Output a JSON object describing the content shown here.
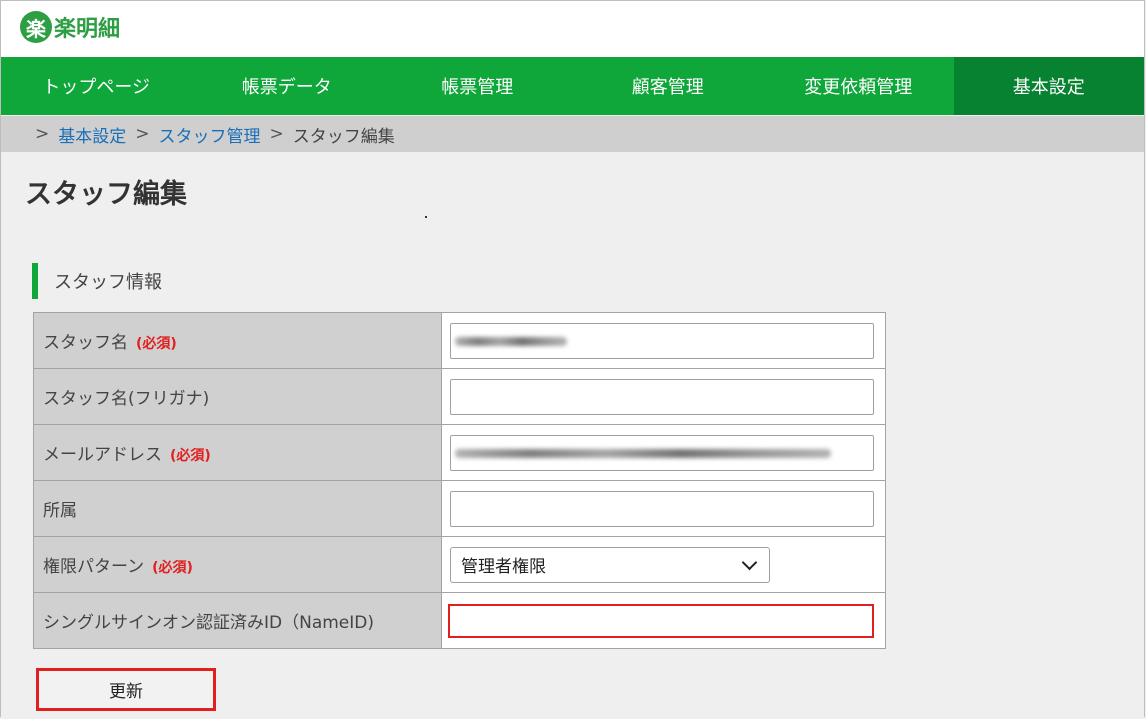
{
  "app": {
    "logo_mark": "楽",
    "logo_text": "楽明細"
  },
  "nav": [
    {
      "label": "トップページ",
      "active": false
    },
    {
      "label": "帳票データ",
      "active": false
    },
    {
      "label": "帳票管理",
      "active": false
    },
    {
      "label": "顧客管理",
      "active": false
    },
    {
      "label": "変更依頼管理",
      "active": false
    },
    {
      "label": "基本設定",
      "active": true
    }
  ],
  "breadcrumb": {
    "separator": ">",
    "items": [
      "基本設定",
      "スタッフ管理",
      "スタッフ編集"
    ]
  },
  "page_title": "スタッフ編集",
  "section": {
    "title": "スタッフ情報"
  },
  "form": {
    "required_label": "(必須)",
    "rows": [
      {
        "label": "スタッフ名",
        "value": ""
      },
      {
        "label": "スタッフ名(フリガナ)",
        "value": ""
      },
      {
        "label": "メールアドレス",
        "value": ""
      },
      {
        "label": "所属",
        "value": ""
      },
      {
        "label": "権限パターン",
        "selected": "管理者権限"
      },
      {
        "label": "シングルサインオン認証済みID（NameID)",
        "value": ""
      }
    ]
  },
  "buttons": {
    "update_label": "更新"
  },
  "colors": {
    "nav_bg": "#0fa63a",
    "nav_active": "#078230",
    "required": "#e01f1f",
    "highlight": "#e01f1f"
  }
}
